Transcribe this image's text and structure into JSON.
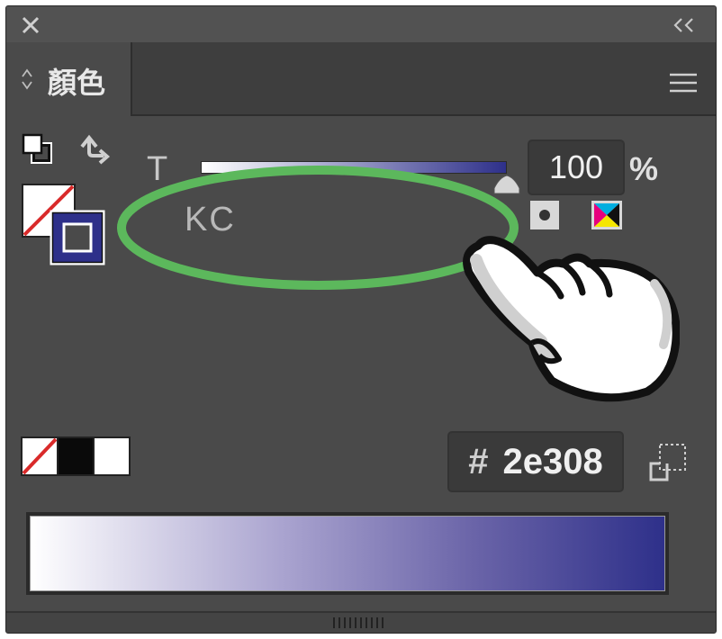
{
  "window": {
    "tab_title": "顏色"
  },
  "tint": {
    "label": "T",
    "value": "100",
    "unit": "%",
    "fraction": 1.0
  },
  "swatch": {
    "name": "KC"
  },
  "hex": {
    "symbol": "#",
    "value": "2e308"
  },
  "colors": {
    "panel": "#4a4a4a",
    "accent_blue": "#2e308a",
    "highlight_green": "#5cb85c",
    "none_red": "#d92a2a"
  },
  "icons": [
    "close-icon",
    "collapse-icon",
    "tab-updown-icon",
    "menu-icon",
    "default-fill-stroke-icon",
    "swap-icon",
    "fill-swatch",
    "stroke-swatch",
    "slider-thumb-icon",
    "spot-color-icon",
    "process-color-icon",
    "none-swatch",
    "black-swatch",
    "white-swatch",
    "out-of-web-gamut-icon",
    "pointing-hand-icon"
  ]
}
